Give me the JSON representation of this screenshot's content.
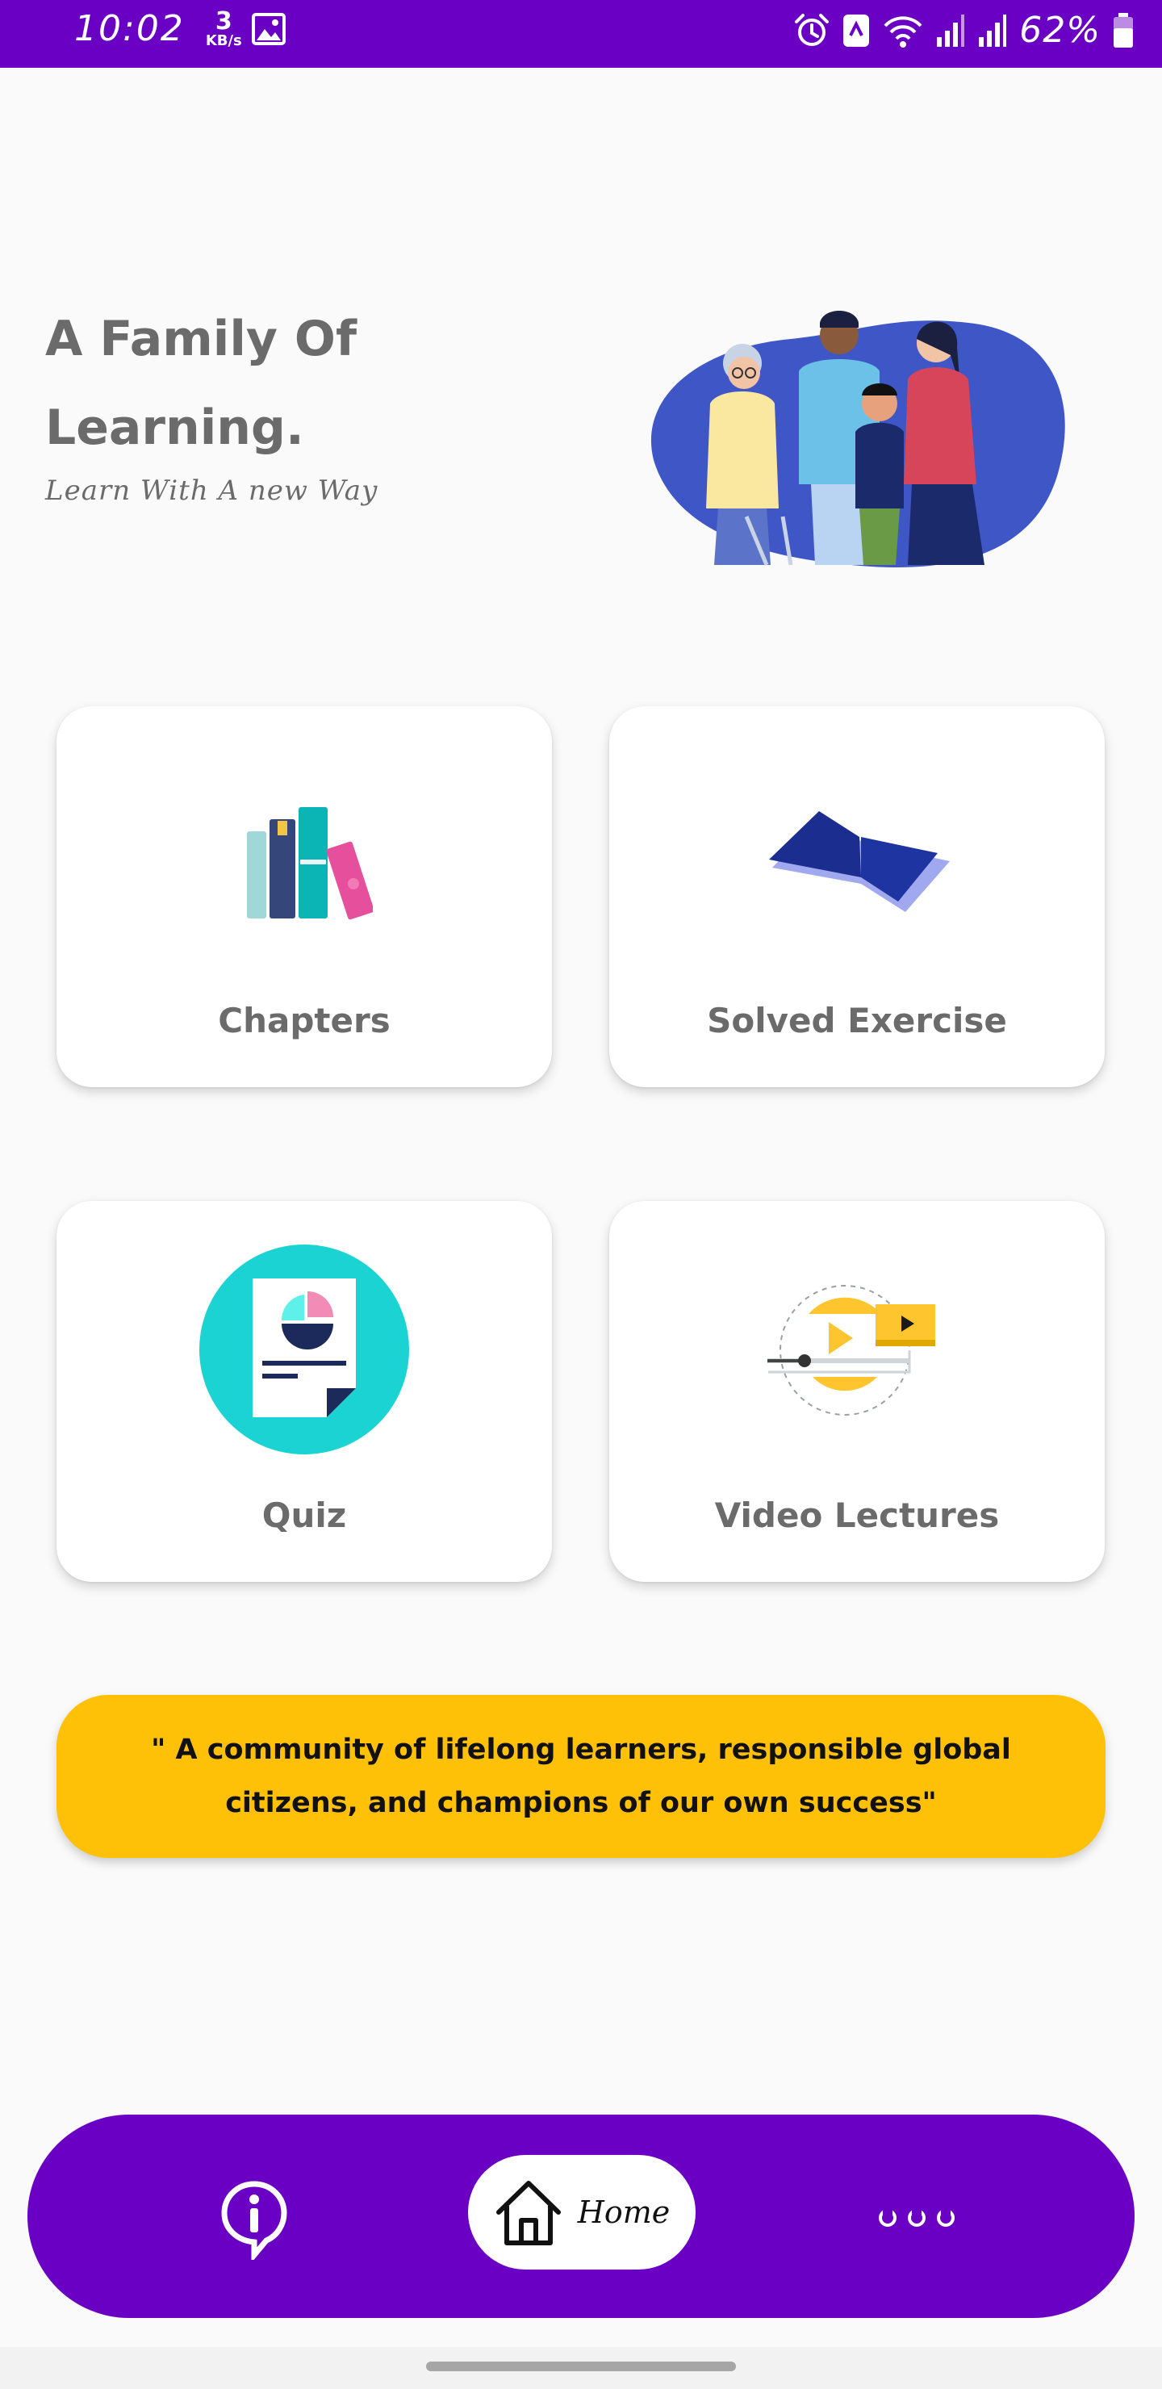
{
  "status_bar": {
    "time": "10:02",
    "net_speed_value": "3",
    "net_speed_unit": "KB/s",
    "battery_percent": "62%",
    "background": "#6a00c4",
    "icons": [
      "image-icon",
      "alarm-icon",
      "nfc-icon",
      "data-saver-icon",
      "wifi-icon",
      "signal-1-icon",
      "signal-2-icon",
      "battery-icon"
    ]
  },
  "hero": {
    "title": "A Family Of Learning.",
    "subtitle": "Learn With A new Way"
  },
  "cards": {
    "chapters": "Chapters",
    "solved_exercise": "Solved Exercise",
    "quiz": "Quiz",
    "video_lectures": "Video Lectures"
  },
  "quote": "\" A community of lifelong learners, responsible global citizens, and champions of our own success\"",
  "bottom_nav": {
    "home_label": "Home",
    "accent": "#6a00c4",
    "items": [
      "info-icon",
      "home-icon",
      "more-icon"
    ]
  },
  "colors": {
    "quote_bg": "#ffc107",
    "quiz_circle": "#1bd3d3",
    "book_blue": "#1b2e8f"
  }
}
